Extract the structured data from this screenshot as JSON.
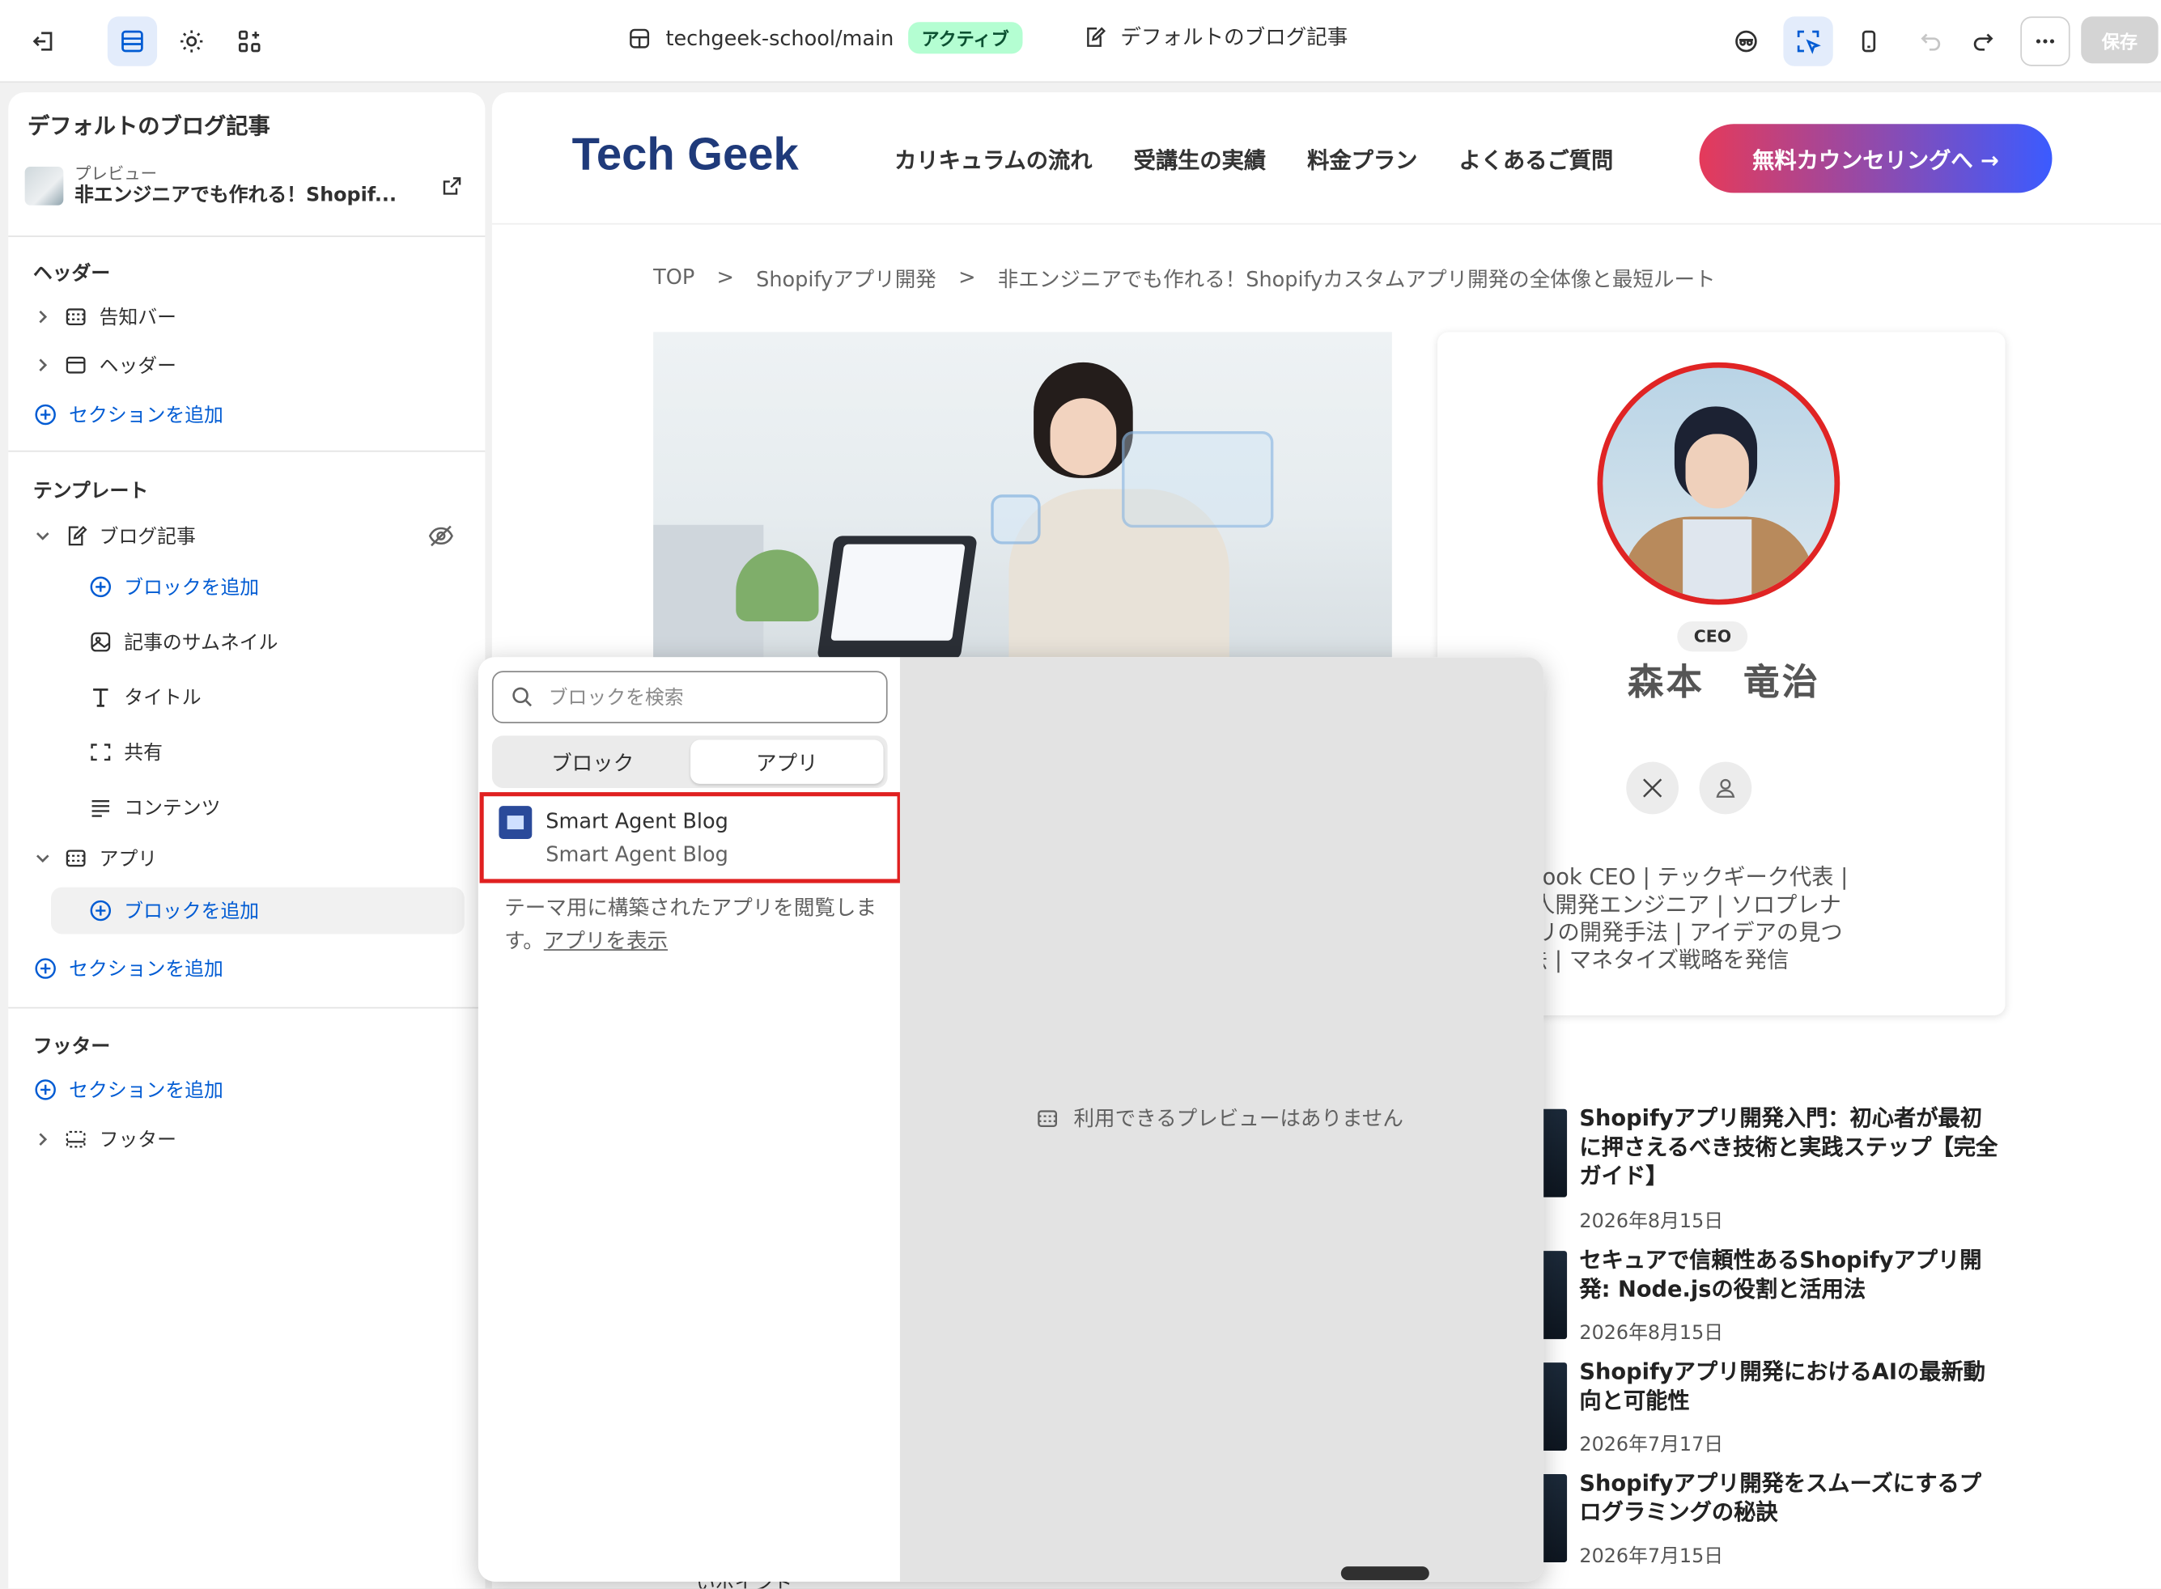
{
  "topbar": {
    "store_path": "techgeek-school/main",
    "status_badge": "アクティブ",
    "template_name": "デフォルトのブログ記事",
    "save_label": "保存"
  },
  "sidebar": {
    "title": "デフォルトのブログ記事",
    "preview_label": "プレビュー",
    "preview_title": "非エンジニアでも作れる！Shopif...",
    "header_section": "ヘッダー",
    "header_items": [
      "告知バー",
      "ヘッダー"
    ],
    "add_section": "セクションを追加",
    "template_section": "テンプレート",
    "blog_post": "ブログ記事",
    "add_block": "ブロックを追加",
    "blog_blocks": [
      "記事のサムネイル",
      "タイトル",
      "共有",
      "コンテンツ"
    ],
    "apps": "アプリ",
    "footer_section": "フッター",
    "footer_item": "フッター"
  },
  "site": {
    "logo": "Tech Geek",
    "nav": [
      "カリキュラムの流れ",
      "受講生の実績",
      "料金プラン",
      "よくあるご質問"
    ],
    "cta": "無料カウンセリングへ →",
    "breadcrumb": [
      "TOP",
      ">",
      "Shopifyアプリ開発",
      ">",
      "非エンジニアでも作れる！Shopifyカスタムアプリ開発の全体像と最短ルート"
    ],
    "author": {
      "badge": "CEO",
      "name": "森本　竜治",
      "bio": [
        "社ForestBook CEO | テックギーク代表 |",
        "/アプリ個人開発エンジニア | ソロプレナ",
        "opifyアプリの開発手法 | アイデアの見つ",
        "マーケ手法 | マネタイズ戦略を発信"
      ]
    },
    "related": [
      {
        "title": "Shopifyアプリ開発入門：初心者が最初に押さえるべき技術と実践ステップ【完全ガイド】",
        "date": "2026年8月15日"
      },
      {
        "title": "セキュアで信頼性あるShopifyアプリ開発: Node.jsの役割と活用法",
        "date": "2026年8月15日"
      },
      {
        "title": "Shopifyアプリ開発におけるAIの最新動向と可能性",
        "date": "2026年7月17日"
      },
      {
        "title": "Shopifyアプリ開発をスムーズにするプログラミングの秘訣",
        "date": "2026年7月15日"
      }
    ],
    "footer_snippet": "いポイント"
  },
  "popover": {
    "search_placeholder": "ブロックを検索",
    "tab_blocks": "ブロック",
    "tab_apps": "アプリ",
    "app_name": "Smart Agent Blog",
    "app_provider": "Smart Agent Blog",
    "note_text": "テーマ用に構築されたアプリを閲覧します。",
    "note_link": "アプリを表示",
    "no_preview": "利用できるプレビューはありません"
  }
}
